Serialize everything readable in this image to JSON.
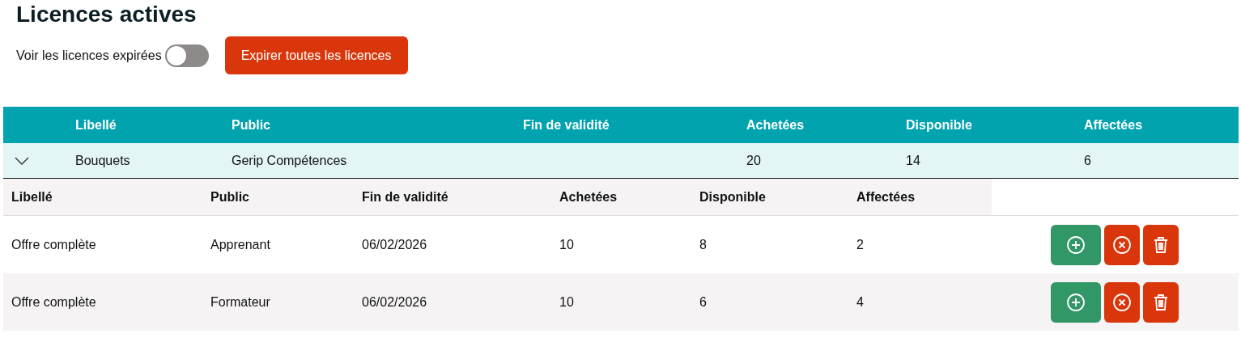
{
  "title": "Licences actives",
  "toggle": {
    "label": "Voir les licences expirées",
    "on": false
  },
  "expire_button": "Expirer toutes les licences",
  "table": {
    "columns": [
      "Libellé",
      "Public",
      "Fin de validité",
      "Achetées",
      "Disponible",
      "Affectées"
    ],
    "groups": [
      {
        "expanded": true,
        "cells": [
          "Bouquets",
          "Gerip Compétences",
          "",
          "20",
          "14",
          "6"
        ],
        "sub_columns": [
          "Libellé",
          "Public",
          "Fin de validité",
          "Achetées",
          "Disponible",
          "Affectées"
        ],
        "rows": [
          {
            "cells": [
              "Offre complète",
              "Apprenant",
              "06/02/2026",
              "10",
              "8",
              "2"
            ]
          },
          {
            "cells": [
              "Offre complète",
              "Formateur",
              "06/02/2026",
              "10",
              "6",
              "4"
            ]
          }
        ]
      }
    ]
  }
}
